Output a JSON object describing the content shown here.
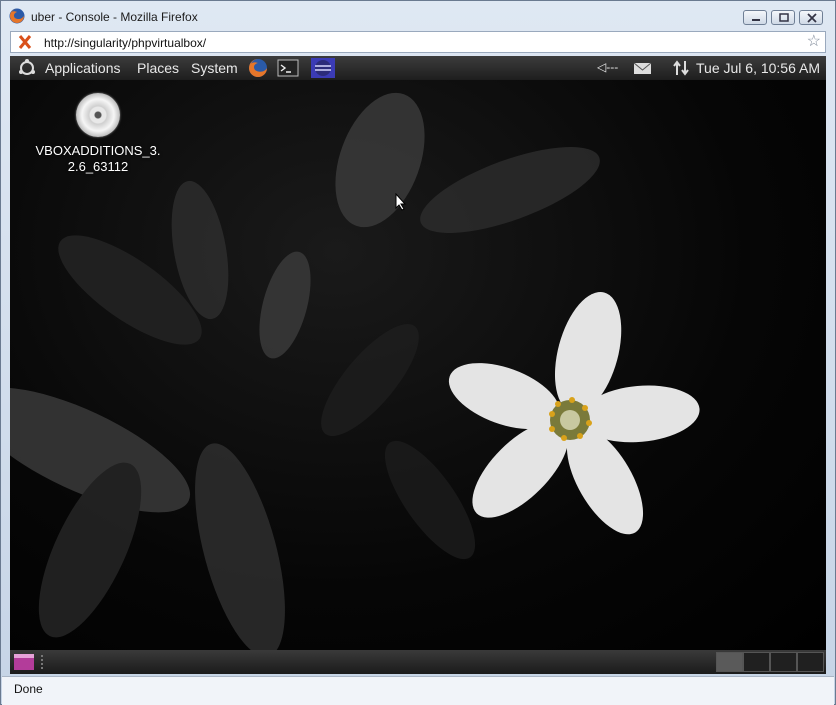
{
  "window": {
    "title": "uber - Console - Mozilla Firefox",
    "url": "http://singularity/phpvirtualbox/",
    "status": "Done",
    "icons": {
      "browser": "firefox-icon",
      "site": "vbox-site-icon",
      "bookmark": "star-icon"
    }
  },
  "gnome": {
    "top_menu": [
      "Applications",
      "Places",
      "System"
    ],
    "launchers": [
      "firefox-launcher-icon",
      "terminal-launcher-icon",
      "eclipse-launcher-icon"
    ],
    "volume_text": "◁---",
    "clock": "Tue Jul  6, 10:56 AM"
  },
  "desktop": {
    "icon_label": "VBOXADDITIONS_3.\n2.6_63112"
  },
  "colors": {
    "panel": "#2a2a2a",
    "window_frame": "#c6d4e6"
  }
}
